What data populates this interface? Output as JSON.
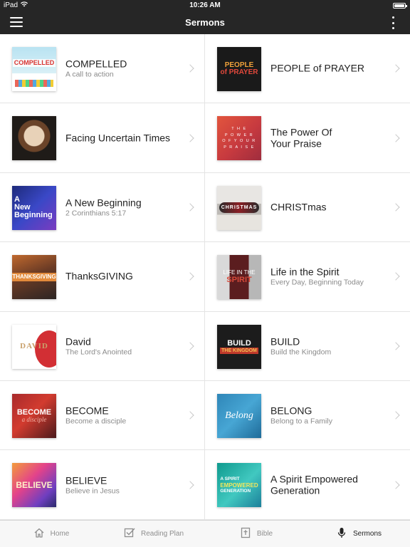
{
  "status_bar": {
    "carrier": "iPad",
    "time": "10:26 AM",
    "wifi_icon": "wifi-icon",
    "battery_icon": "battery-icon"
  },
  "nav": {
    "title": "Sermons",
    "menu_icon": "hamburger-menu-icon",
    "more_icon": "more-vertical-icon"
  },
  "series": [
    {
      "title": "COMPELLED",
      "subtitle": "A call to action",
      "thumb": {
        "text": "COMPELLED"
      }
    },
    {
      "title": "PEOPLE of PRAYER",
      "subtitle": "",
      "thumb": {
        "text": "PEOPLE",
        "text2": "of PRAYER"
      }
    },
    {
      "title": "Facing Uncertain Times",
      "subtitle": "",
      "thumb": {
        "text": ""
      }
    },
    {
      "title": "The Power Of\nYour Praise",
      "subtitle": "",
      "thumb": {
        "text": "T H E\nP O W E R\nO F   Y O U R\nP R A I S E"
      }
    },
    {
      "title": "A New Beginning",
      "subtitle": "2 Corinthians 5:17",
      "thumb": {
        "text": "A\nNew\nBeginning"
      }
    },
    {
      "title": "CHRISTmas",
      "subtitle": "",
      "thumb": {
        "text": "CHRISTMAS"
      }
    },
    {
      "title": "ThanksGIVING",
      "subtitle": "",
      "thumb": {
        "text": "THANKSGIVING"
      }
    },
    {
      "title": "Life in the Spirit",
      "subtitle": "Every Day, Beginning Today",
      "thumb": {
        "text": "LIFE IN THE",
        "text2": "SPIRIT"
      }
    },
    {
      "title": "David",
      "subtitle": "The Lord's Anointed",
      "thumb": {
        "text": "DAVID"
      }
    },
    {
      "title": "BUILD",
      "subtitle": "Build the Kingdom",
      "thumb": {
        "text": "BUILD",
        "text2": "THE KINGDOM"
      }
    },
    {
      "title": "BECOME",
      "subtitle": "Become a disciple",
      "thumb": {
        "text": "BECOME",
        "text2": "a disciple"
      }
    },
    {
      "title": "BELONG",
      "subtitle": "Belong to a Family",
      "thumb": {
        "text": "Belong"
      }
    },
    {
      "title": "BELIEVE",
      "subtitle": "Believe in Jesus",
      "thumb": {
        "text": "BELIEVE"
      }
    },
    {
      "title": "A Spirit Empowered\nGeneration",
      "subtitle": "",
      "thumb": {
        "text": "A SPIRIT",
        "text2": "EMPOWERED",
        "text3": "GENERATION"
      }
    }
  ],
  "tabs": [
    {
      "label": "Home",
      "icon": "home-icon",
      "active": false
    },
    {
      "label": "Reading Plan",
      "icon": "checkbox-icon",
      "active": false
    },
    {
      "label": "Bible",
      "icon": "bible-icon",
      "active": false
    },
    {
      "label": "Sermons",
      "icon": "microphone-icon",
      "active": true
    }
  ]
}
